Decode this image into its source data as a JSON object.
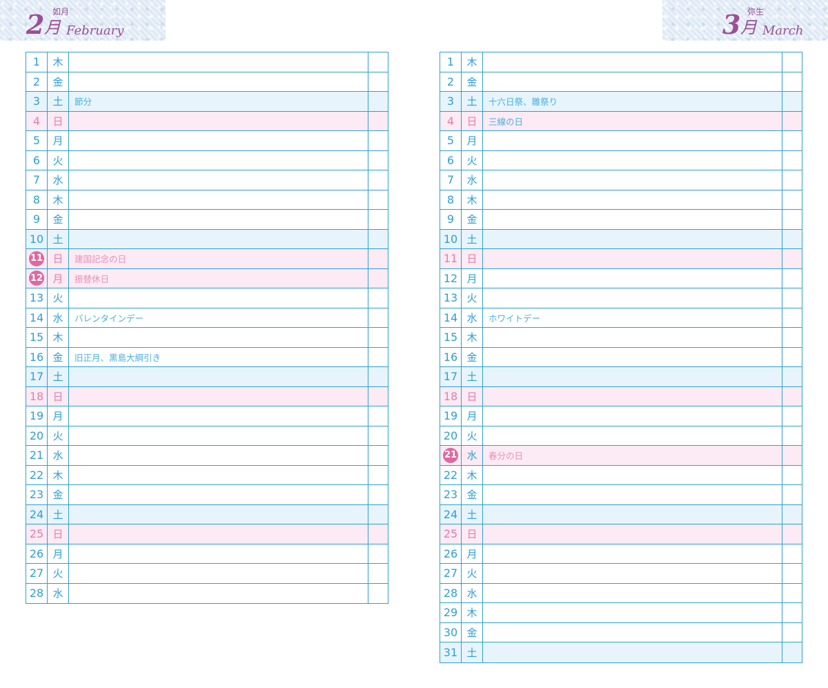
{
  "left": {
    "month_number": "2",
    "month_kanji": "月",
    "traditional_name": "如月",
    "english_name": "February",
    "rows": [
      {
        "day": "1",
        "weekday": "木",
        "note": "",
        "type": "normal"
      },
      {
        "day": "2",
        "weekday": "金",
        "note": "",
        "type": "normal"
      },
      {
        "day": "3",
        "weekday": "土",
        "note": "節分",
        "type": "sat"
      },
      {
        "day": "4",
        "weekday": "日",
        "note": "",
        "type": "hol"
      },
      {
        "day": "5",
        "weekday": "月",
        "note": "",
        "type": "normal"
      },
      {
        "day": "6",
        "weekday": "火",
        "note": "",
        "type": "normal"
      },
      {
        "day": "7",
        "weekday": "水",
        "note": "",
        "type": "normal"
      },
      {
        "day": "8",
        "weekday": "木",
        "note": "",
        "type": "normal"
      },
      {
        "day": "9",
        "weekday": "金",
        "note": "",
        "type": "normal"
      },
      {
        "day": "10",
        "weekday": "土",
        "note": "",
        "type": "sat"
      },
      {
        "day": "11",
        "weekday": "日",
        "note": "建国記念の日",
        "type": "hol",
        "circle": true
      },
      {
        "day": "12",
        "weekday": "月",
        "note": "振替休日",
        "type": "hol",
        "circle": true
      },
      {
        "day": "13",
        "weekday": "火",
        "note": "",
        "type": "normal"
      },
      {
        "day": "14",
        "weekday": "水",
        "note": "バレンタインデー",
        "type": "normal"
      },
      {
        "day": "15",
        "weekday": "木",
        "note": "",
        "type": "normal"
      },
      {
        "day": "16",
        "weekday": "金",
        "note": "旧正月、黒島大綱引き",
        "type": "normal"
      },
      {
        "day": "17",
        "weekday": "土",
        "note": "",
        "type": "sat"
      },
      {
        "day": "18",
        "weekday": "日",
        "note": "",
        "type": "hol"
      },
      {
        "day": "19",
        "weekday": "月",
        "note": "",
        "type": "normal"
      },
      {
        "day": "20",
        "weekday": "火",
        "note": "",
        "type": "normal"
      },
      {
        "day": "21",
        "weekday": "水",
        "note": "",
        "type": "normal"
      },
      {
        "day": "22",
        "weekday": "木",
        "note": "",
        "type": "normal"
      },
      {
        "day": "23",
        "weekday": "金",
        "note": "",
        "type": "normal"
      },
      {
        "day": "24",
        "weekday": "土",
        "note": "",
        "type": "sat"
      },
      {
        "day": "25",
        "weekday": "日",
        "note": "",
        "type": "hol"
      },
      {
        "day": "26",
        "weekday": "月",
        "note": "",
        "type": "normal"
      },
      {
        "day": "27",
        "weekday": "火",
        "note": "",
        "type": "normal"
      },
      {
        "day": "28",
        "weekday": "水",
        "note": "",
        "type": "normal"
      }
    ]
  },
  "right": {
    "month_number": "3",
    "month_kanji": "月",
    "traditional_name": "弥生",
    "english_name": "March",
    "rows": [
      {
        "day": "1",
        "weekday": "木",
        "note": "",
        "type": "normal"
      },
      {
        "day": "2",
        "weekday": "金",
        "note": "",
        "type": "normal"
      },
      {
        "day": "3",
        "weekday": "土",
        "note": "十六日祭、雛祭り",
        "type": "sat"
      },
      {
        "day": "4",
        "weekday": "日",
        "note": "三線の日",
        "type": "hol",
        "note_blue": true
      },
      {
        "day": "5",
        "weekday": "月",
        "note": "",
        "type": "normal"
      },
      {
        "day": "6",
        "weekday": "火",
        "note": "",
        "type": "normal"
      },
      {
        "day": "7",
        "weekday": "水",
        "note": "",
        "type": "normal"
      },
      {
        "day": "8",
        "weekday": "木",
        "note": "",
        "type": "normal"
      },
      {
        "day": "9",
        "weekday": "金",
        "note": "",
        "type": "normal"
      },
      {
        "day": "10",
        "weekday": "土",
        "note": "",
        "type": "sat"
      },
      {
        "day": "11",
        "weekday": "日",
        "note": "",
        "type": "hol"
      },
      {
        "day": "12",
        "weekday": "月",
        "note": "",
        "type": "normal"
      },
      {
        "day": "13",
        "weekday": "火",
        "note": "",
        "type": "normal"
      },
      {
        "day": "14",
        "weekday": "水",
        "note": "ホワイトデー",
        "type": "normal"
      },
      {
        "day": "15",
        "weekday": "木",
        "note": "",
        "type": "normal"
      },
      {
        "day": "16",
        "weekday": "金",
        "note": "",
        "type": "normal"
      },
      {
        "day": "17",
        "weekday": "土",
        "note": "",
        "type": "sat"
      },
      {
        "day": "18",
        "weekday": "日",
        "note": "",
        "type": "hol"
      },
      {
        "day": "19",
        "weekday": "月",
        "note": "",
        "type": "normal"
      },
      {
        "day": "20",
        "weekday": "火",
        "note": "",
        "type": "normal"
      },
      {
        "day": "21",
        "weekday": "水",
        "note": "春分の日",
        "type": "hol",
        "circle": true,
        "weekday_blue": true
      },
      {
        "day": "22",
        "weekday": "木",
        "note": "",
        "type": "normal"
      },
      {
        "day": "23",
        "weekday": "金",
        "note": "",
        "type": "normal"
      },
      {
        "day": "24",
        "weekday": "土",
        "note": "",
        "type": "sat"
      },
      {
        "day": "25",
        "weekday": "日",
        "note": "",
        "type": "hol"
      },
      {
        "day": "26",
        "weekday": "月",
        "note": "",
        "type": "normal"
      },
      {
        "day": "27",
        "weekday": "火",
        "note": "",
        "type": "normal"
      },
      {
        "day": "28",
        "weekday": "水",
        "note": "",
        "type": "normal"
      },
      {
        "day": "29",
        "weekday": "木",
        "note": "",
        "type": "normal"
      },
      {
        "day": "30",
        "weekday": "金",
        "note": "",
        "type": "normal"
      },
      {
        "day": "31",
        "weekday": "土",
        "note": "",
        "type": "sat"
      }
    ]
  },
  "colors": {
    "line": "#2b9fd9",
    "saturday_bg": "#e7f4fc",
    "holiday_bg": "#fcebf4",
    "holiday_text": "#e97aa9",
    "circle": "#e0689f",
    "heading": "#9a4f96"
  }
}
